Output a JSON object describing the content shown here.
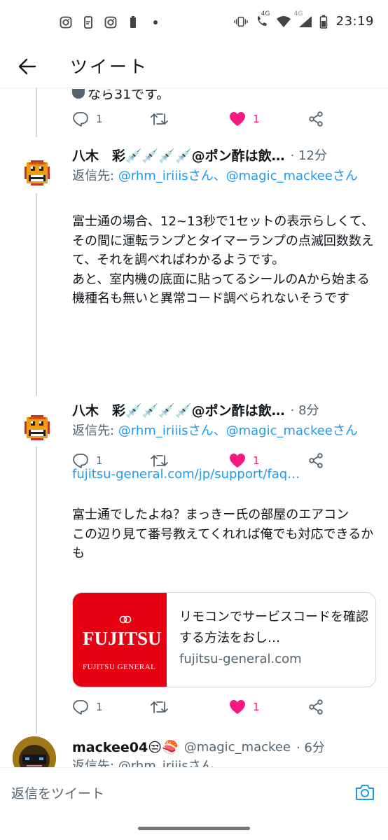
{
  "status_bar": {
    "time": "23:19",
    "network": "4G",
    "network2": "4G",
    "icons": [
      "instagram-icon",
      "screenshot-icon",
      "instagram-icon",
      "battery-icon",
      "dot-icon",
      "vibrate-icon",
      "wifi-calling-icon",
      "wifi-icon",
      "signal-icon",
      "battery-icon"
    ]
  },
  "header": {
    "title": "ツイート",
    "back_icon": "arrow-left-icon"
  },
  "previous_tweet": {
    "text_fragment": "なら31です。",
    "replies": "1",
    "likes": "1"
  },
  "tweets": [
    {
      "name": "八木　彩💉💉💉💉@ポン酢は飲…",
      "time": "· 12分",
      "reply_to_label": "返信先: ",
      "reply_to_mentions": "@rhm_iriiisさん、@magic_mackeeさん",
      "body": "富士通の場合、12~13秒で1セットの表示らしくて、その間に運転ランプとタイマーランプの点滅回数数えて、それを調べればわかるようです。\nあと、室内機の底面に貼ってるシールのAから始まる機種名も無いと異常コード調べられないそうです",
      "replies": "1",
      "likes": "1"
    },
    {
      "name": "八木　彩💉💉💉💉@ポン酢は飲…",
      "time": "· 8分",
      "reply_to_label": "返信先: ",
      "reply_to_mentions": "@rhm_iriiisさん、@magic_mackeeさん",
      "link": "fujitsu-general.com/jp/support/faq…",
      "body": "富士通でしたよね？まっきー氏の部屋のエアコン\nこの辺り見て番号教えてくれれば俺でも対応できるかも",
      "card": {
        "logo_text": "FUJITSU",
        "logo_sub": "FUJITSU GENERAL",
        "title": "リモコンでサービスコードを確認する方法をおし…",
        "domain": "fujitsu-general.com"
      },
      "replies": "1",
      "likes": "1"
    },
    {
      "name": "mackee04😒🍣",
      "handle": "@magic_mackee",
      "time": "· 6分",
      "reply_to_label": "返信先: @rhm_iriiisさん、"
    }
  ],
  "composer": {
    "placeholder": "返信をツイート"
  },
  "colors": {
    "accent": "#1d9bf0",
    "like": "#f91880",
    "fujitsu_red": "#e60012",
    "text": "#0f1419",
    "muted": "#536471"
  }
}
